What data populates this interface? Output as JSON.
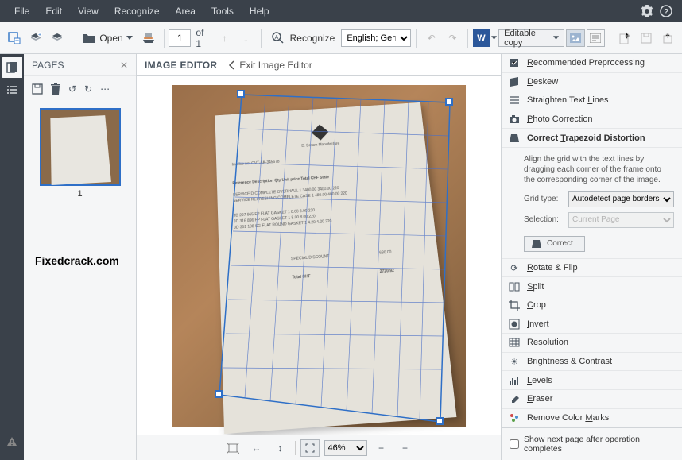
{
  "menubar": {
    "items": [
      "File",
      "Edit",
      "View",
      "Recognize",
      "Area",
      "Tools",
      "Help"
    ]
  },
  "toolbar": {
    "open_label": "Open",
    "page_current": "1",
    "page_of": "of 1",
    "recognize_label": "Recognize",
    "language": "English; German",
    "copy_mode": "Editable copy"
  },
  "pages": {
    "title": "PAGES",
    "thumb_label": "1"
  },
  "editor": {
    "title": "IMAGE EDITOR",
    "exit_label": "Exit Image Editor",
    "zoom_value": "46%"
  },
  "doc": {
    "company": "D. Bream Manufacture",
    "invoice": "Invoice no: OVT-AK-345678",
    "headers": "Reference    Description                Qty  Unit price  Total CHF  State",
    "rows": [
      "SERVICE D    COMPLETE OVERHAUL         1   3400.00    3400.00   220",
      "SERVICE      REFRESHING COMPLETE CASE  1    480.00     480.00   220",
      "JD 297 965 FP  FLAT GASKET            1     8.00       8.00    220",
      "JD 316 896 FP  FLAT GASKET            1     8.00       8.00    220",
      "JD 351 108 SG  FLAT ROUND GASKET      1     4.20       4.20    220"
    ],
    "discount_label": "SPECIAL DISCOUNT",
    "discount_val": "-680.00",
    "total_label": "Total CHF",
    "total_val": "2720.92"
  },
  "right": {
    "tools": [
      {
        "label": "Recommended Preprocessing",
        "hot": "R"
      },
      {
        "label": "Deskew",
        "hot": "D"
      },
      {
        "label": "Straighten Text Lines",
        "hot": "L"
      },
      {
        "label": "Photo Correction",
        "hot": "P"
      },
      {
        "label": "Correct Trapezoid Distortion",
        "hot": "T"
      }
    ],
    "trapezoid_desc": "Align the grid with the text lines by dragging each corner of the frame onto the corresponding corner of the image.",
    "grid_type_label": "Grid type:",
    "grid_type_value": "Autodetect page borders",
    "selection_label": "Selection:",
    "selection_value": "Current Page",
    "correct_btn": "Correct",
    "tools2": [
      {
        "label": "Rotate & Flip",
        "hot": "R"
      },
      {
        "label": "Split",
        "hot": "S"
      },
      {
        "label": "Crop",
        "hot": "C"
      },
      {
        "label": "Invert",
        "hot": "I"
      },
      {
        "label": "Resolution",
        "hot": "R"
      },
      {
        "label": "Brightness & Contrast",
        "hot": "B"
      },
      {
        "label": "Levels",
        "hot": "L"
      },
      {
        "label": "Eraser",
        "hot": "E"
      },
      {
        "label": "Remove Color Marks",
        "hot": "M"
      }
    ],
    "show_next": "Show next page after operation completes"
  },
  "watermark": "Fixedcrack.com"
}
